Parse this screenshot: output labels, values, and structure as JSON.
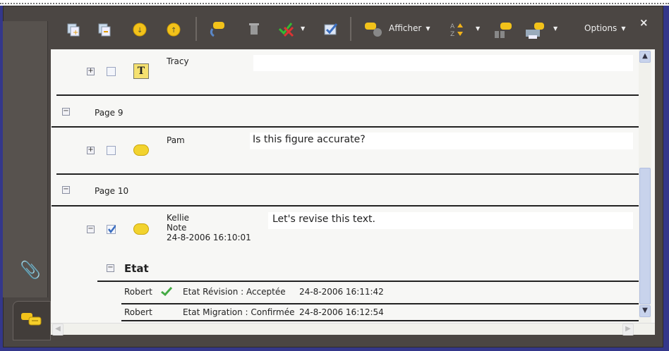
{
  "toolbar": {
    "buttons": [
      "expand-all",
      "collapse-all",
      "next",
      "previous",
      "reply",
      "delete",
      "set-status",
      "mark-checked"
    ],
    "show_label": "Afficher",
    "options_label": "Options",
    "close": "×"
  },
  "comments": [
    {
      "author": "Tracy",
      "text": "",
      "type": "text"
    },
    {
      "page_label": "Page 9"
    },
    {
      "author": "Pam",
      "text": "Is this figure accurate?",
      "type": "note"
    },
    {
      "page_label": "Page 10"
    },
    {
      "author": "Kellie",
      "kind": "Note",
      "date": "24-8-2006 16:10:01",
      "text": "Let's revise this text.",
      "type": "note"
    }
  ],
  "status": {
    "heading": "Etat",
    "rows": [
      {
        "user": "Robert",
        "text": "Etat Révision : Acceptée",
        "date": "24-8-2006 16:11:42"
      },
      {
        "user": "Robert",
        "text": "Etat Migration : Confirmée",
        "date": "24-8-2006 16:12:54"
      }
    ]
  },
  "colors": {
    "accent": "#f2d32e",
    "bg": "#4b4643",
    "scroll": "#c8d3ec"
  }
}
